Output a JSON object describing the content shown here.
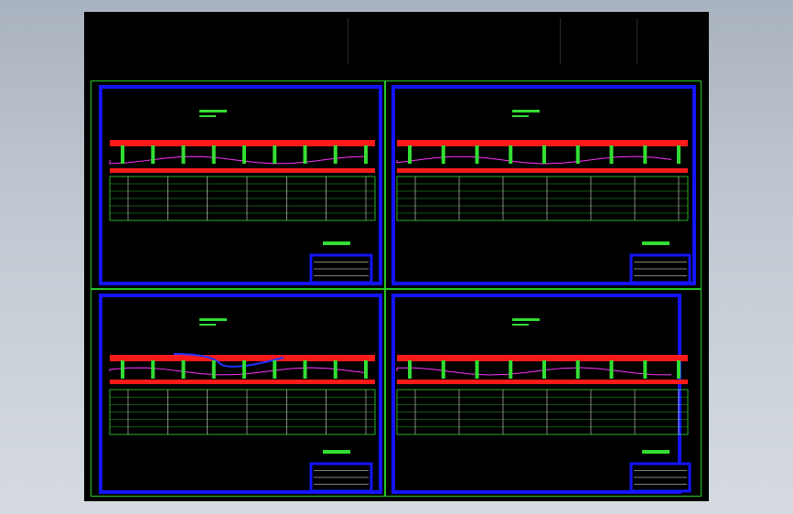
{
  "viewport": {
    "name": "model space",
    "background": "#000000"
  },
  "colors": {
    "border_green": "#27c827",
    "frame_blue": "#1414ff",
    "band_red": "#ff1a1a",
    "profile_magenta": "#ff33ff",
    "grid_green": "#33dd33",
    "accent_blue": "#2233ff"
  },
  "sheets": [
    {
      "id": "sheet-1",
      "title": "",
      "scale": ""
    },
    {
      "id": "sheet-2",
      "title": "",
      "scale": ""
    },
    {
      "id": "sheet-3",
      "title": "",
      "scale": ""
    },
    {
      "id": "sheet-4",
      "title": "",
      "scale": ""
    }
  ]
}
